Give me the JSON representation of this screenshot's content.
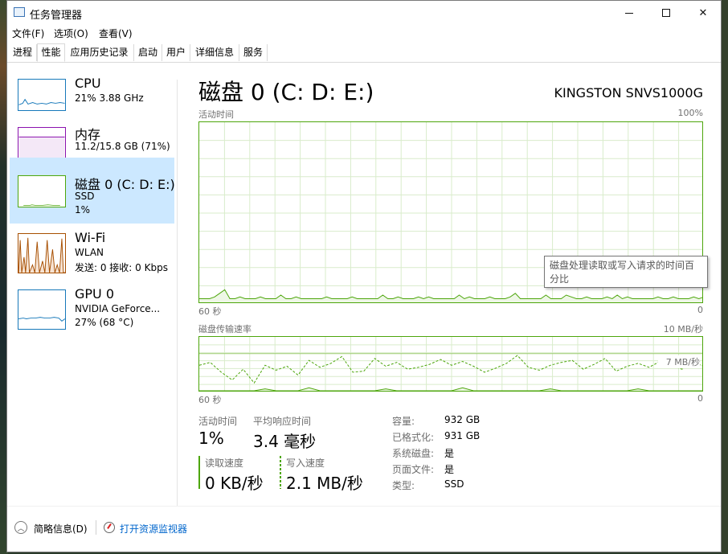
{
  "window": {
    "title": "任务管理器"
  },
  "menu": [
    "文件(F)",
    "选项(O)",
    "查看(V)"
  ],
  "tabs": [
    "进程",
    "性能",
    "应用历史记录",
    "启动",
    "用户",
    "详细信息",
    "服务"
  ],
  "active_tab": "性能",
  "sidebar": {
    "items": [
      {
        "title": "CPU",
        "sub1": "21% 3.88 GHz",
        "sub2": "",
        "color": "#1779ba"
      },
      {
        "title": "内存",
        "sub1": "11.2/15.8 GB (71%)",
        "sub2": "",
        "color": "#8b12ae"
      },
      {
        "title": "磁盘 0 (C: D: E:)",
        "sub1": "SSD",
        "sub2": "1%",
        "color": "#4da60c"
      },
      {
        "title": "Wi-Fi",
        "sub1": "WLAN",
        "sub2": "发送: 0 接收: 0 Kbps",
        "color": "#a74f01"
      },
      {
        "title": "GPU 0",
        "sub1": "NVIDIA GeForce...",
        "sub2": "27% (68 °C)",
        "color": "#1779ba"
      }
    ]
  },
  "main": {
    "title": "磁盘 0 (C: D: E:)",
    "model": "KINGSTON SNVS1000G",
    "graph1": {
      "label": "活动时间",
      "max": "100%",
      "time": "60 秒",
      "min": "0",
      "values": [
        2,
        2,
        2,
        3,
        5,
        7,
        2,
        2,
        3,
        2,
        2,
        2,
        3,
        2,
        2,
        2,
        4,
        2,
        2,
        3,
        2,
        2,
        2,
        2,
        2,
        3,
        2,
        2,
        2,
        2,
        3,
        2,
        2,
        2,
        2,
        2,
        4,
        2,
        2,
        3,
        2,
        2,
        2,
        3,
        2,
        3,
        2,
        2,
        2,
        2,
        2,
        4,
        2,
        3,
        2,
        2,
        2,
        3,
        2,
        2,
        2,
        3,
        5,
        2,
        2,
        2,
        2,
        2,
        4,
        2,
        2,
        2,
        4,
        3,
        2,
        2,
        3,
        2,
        2,
        2,
        3,
        2,
        4,
        2,
        3,
        2,
        2,
        2,
        2,
        2,
        3,
        2,
        2,
        3,
        2,
        2,
        2,
        3,
        2,
        3
      ]
    },
    "tooltip": "磁盘处理读取或写入请求的时间百分比",
    "graph2": {
      "label": "磁盘传输速率",
      "max": "10 MB/秒",
      "scale_line": "7 MB/秒",
      "time": "60 秒",
      "min": "0",
      "write": [
        2.6,
        2.9,
        1.9,
        1.1,
        2.2,
        0.8,
        2.6,
        2.1,
        2.5,
        1.6,
        3.1,
        2.4,
        2.8,
        3.5,
        1.9,
        2.0,
        3.3,
        2.5,
        2.9,
        2.2,
        2.4,
        2.7,
        3.2,
        2.6,
        3.0,
        2.5,
        1.9,
        2.3,
        2.8,
        3.6,
        2.4,
        2.1,
        2.6,
        2.9,
        3.1,
        2.2,
        2.7,
        3.3,
        2.0,
        2.5,
        2.8,
        2.4,
        3.0,
        2.6,
        2.2,
        2.9,
        2.5
      ],
      "read": [
        0,
        0,
        0,
        0,
        0,
        0,
        0.2,
        0,
        0,
        0,
        0.3,
        0,
        0,
        0,
        0,
        0,
        0,
        0.2,
        0,
        0,
        0,
        0,
        0,
        0,
        0.3,
        0,
        0,
        0,
        0,
        0,
        0,
        0,
        0.2,
        0,
        0,
        0,
        0,
        0,
        0,
        0,
        0.2,
        0,
        0,
        0,
        0,
        0,
        0
      ]
    }
  },
  "stats": {
    "active_time": {
      "label": "活动时间",
      "value": "1%"
    },
    "avg_response": {
      "label": "平均响应时间",
      "value": "3.4 毫秒"
    },
    "read_speed": {
      "label": "读取速度",
      "value": "0 KB/秒"
    },
    "write_speed": {
      "label": "写入速度",
      "value": "2.1 MB/秒"
    }
  },
  "props": [
    {
      "k": "容量:",
      "v": "932 GB"
    },
    {
      "k": "已格式化:",
      "v": "931 GB"
    },
    {
      "k": "系统磁盘:",
      "v": "是"
    },
    {
      "k": "页面文件:",
      "v": "是"
    },
    {
      "k": "类型:",
      "v": "SSD"
    }
  ],
  "footer": {
    "fewer": "简略信息(D)",
    "monitor": "打开资源监视器"
  }
}
